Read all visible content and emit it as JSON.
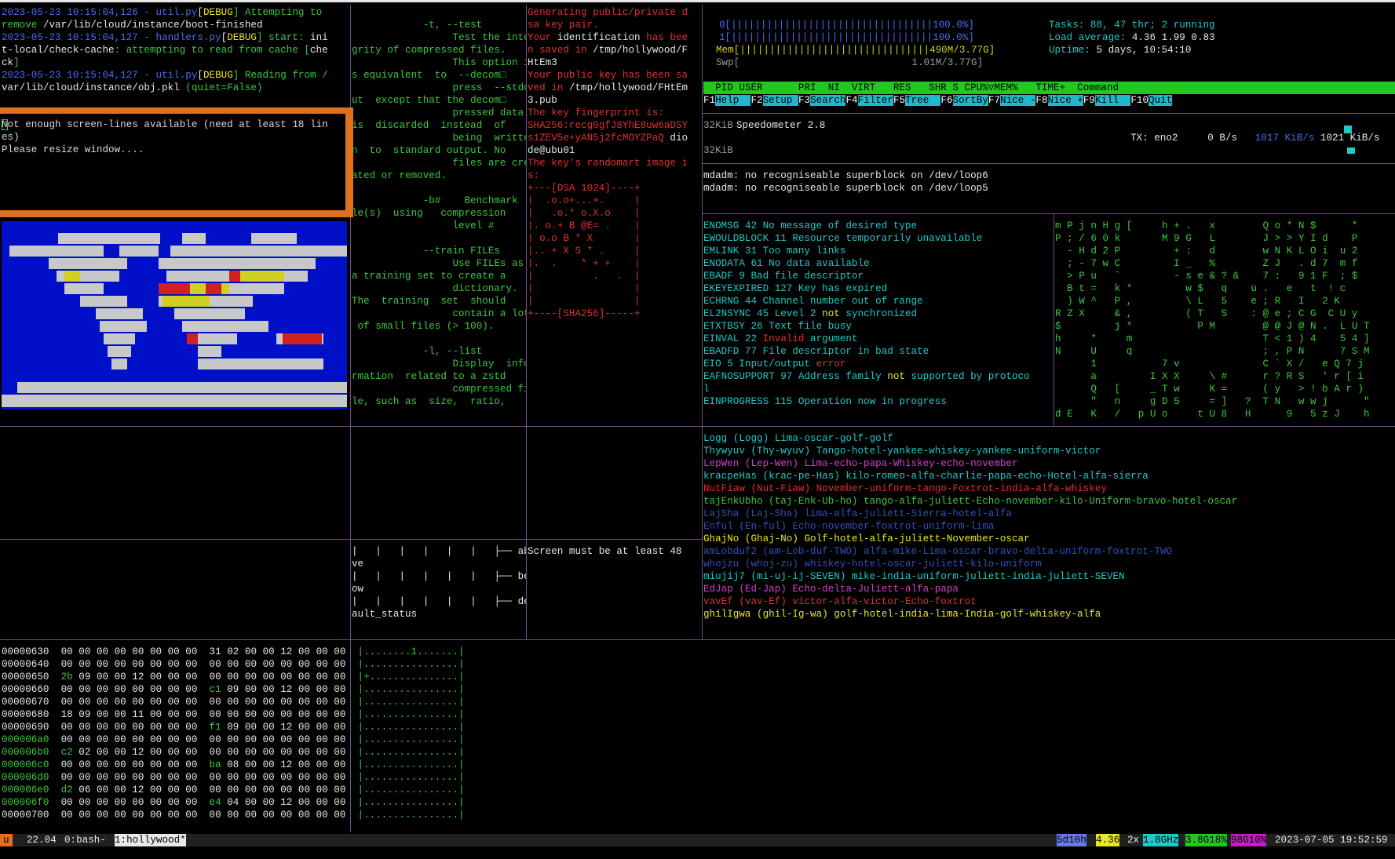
{
  "log_pane": {
    "lines": [
      [
        [
          "2023-05-23 10:15:04,126 - ",
          "c-blue"
        ],
        [
          "util.py",
          "c-blue"
        ],
        [
          "[",
          "c-white"
        ],
        [
          "DEBUG",
          "c-yellow"
        ],
        [
          "] Attempting to",
          "c-green"
        ]
      ],
      [
        [
          "remove ",
          "c-green"
        ],
        [
          "/var/lib/cloud/instance/boot-finished",
          "c-white"
        ]
      ],
      [
        [
          "2023-05-23 10:15:04,127 - ",
          "c-blue"
        ],
        [
          "handlers.py",
          "c-blue"
        ],
        [
          "[",
          "c-white"
        ],
        [
          "DEBUG",
          "c-yellow"
        ],
        [
          "] start: ",
          "c-green"
        ],
        [
          "ini",
          "c-white"
        ]
      ],
      [
        [
          "t-local/check-cache",
          "c-white"
        ],
        [
          ": attempting to read from cache [",
          "c-green"
        ],
        [
          "che",
          "c-white"
        ]
      ],
      [
        [
          "ck",
          "c-white"
        ],
        [
          "]",
          "c-green"
        ]
      ],
      [
        [
          "2023-05-23 10:15:04,127 - ",
          "c-blue"
        ],
        [
          "util.py",
          "c-blue"
        ],
        [
          "[",
          "c-white"
        ],
        [
          "DEBUG",
          "c-yellow"
        ],
        [
          "] Reading from /",
          "c-green"
        ]
      ],
      [
        [
          "var/lib/cloud/instance/obj.pkl",
          "c-white"
        ],
        [
          " (quiet=False)",
          "c-green"
        ]
      ]
    ]
  },
  "warn_pane": {
    "lines": [
      "Not enough screen-lines available (need at least 18 lin",
      "es)",
      "Please resize window...."
    ]
  },
  "zstd_help": {
    "lines": [
      "            -t, --test",
      "                 Test the inte",
      "grity of compressed files.",
      "                 This option i",
      "s equivalent  to  --decom□",
      "                 press  --stdo",
      "ut  except that the decom□",
      "                 pressed data",
      "is  discarded  instead  of",
      "                 being  writte",
      "n  to  standard output. No",
      "                 files are cre",
      "ated or removed.",
      "",
      "            -b#    Benchmark  fi",
      "le(s)  using   compression",
      "                 level #",
      "",
      "            --train FILEs",
      "                 Use FILEs as",
      "a training set to create a",
      "                 dictionary.",
      "The  training  set  should",
      "                 contain a lot",
      " of small files (> 100).",
      "",
      "            -l, --list",
      "                 Display  info",
      "rmation  related to a zstd",
      "                 compressed fi",
      "le, such as  size,  ratio,"
    ]
  },
  "ssh_pane": {
    "lines": [
      [
        [
          "Generating public/private d",
          "c-red"
        ]
      ],
      [
        [
          "sa key pair.",
          "c-red"
        ]
      ],
      [
        [
          "Your ",
          "c-red"
        ],
        [
          "identification",
          "c-white"
        ],
        [
          " has bee",
          "c-red"
        ]
      ],
      [
        [
          "n saved in ",
          "c-red"
        ],
        [
          "/tmp/hollywood/F",
          "c-white"
        ]
      ],
      [
        [
          "HtEm3",
          "c-white"
        ]
      ],
      [
        [
          "Your public key has been sa",
          "c-red"
        ]
      ],
      [
        [
          "ved in ",
          "c-red"
        ],
        [
          "/tmp/hollywood/FHtEm",
          "c-white"
        ]
      ],
      [
        [
          "3.pub",
          "c-white"
        ]
      ],
      [
        [
          "The key fingerprint is:",
          "c-red"
        ]
      ],
      [
        [
          "SHA256:recg0gfJ8YhE8uw6aDSY",
          "c-red"
        ]
      ],
      [
        [
          "s1ZEV5e+yAN5j2fcMOYZPaQ ",
          "c-red"
        ],
        [
          "dio",
          "c-white"
        ]
      ],
      [
        [
          "de@ubu01",
          "c-white"
        ]
      ],
      [
        [
          "The key's randomart image i",
          "c-red"
        ]
      ],
      [
        [
          "s:",
          "c-red"
        ]
      ],
      [
        [
          "+---[DSA 1024]----+",
          "c-red"
        ]
      ],
      [
        [
          "|  .o.o+...+.     |",
          "c-red"
        ]
      ],
      [
        [
          "|   .o.* o.X.o    |",
          "c-red"
        ]
      ],
      [
        [
          "|. o.+ B @E= .    |",
          "c-red"
        ]
      ],
      [
        [
          "| o.o B * X       |",
          "c-red"
        ]
      ],
      [
        [
          "|.. + X S * .     |",
          "c-red"
        ]
      ],
      [
        [
          "|.  .    * + +    |",
          "c-red"
        ]
      ],
      [
        [
          "|          .   .  |",
          "c-red"
        ]
      ],
      [
        [
          "|                 |",
          "c-red"
        ]
      ],
      [
        [
          "|                 |",
          "c-red"
        ]
      ],
      [
        [
          "+----[SHA256]-----+",
          "c-red"
        ]
      ]
    ]
  },
  "htop": {
    "cpu0": "0[||||||||||||||||||||||||||||||||||100.0%]",
    "cpu1": "1[||||||||||||||||||||||||||||||||||100.0%]",
    "mem": "Mem[||||||||||||||||||||||||||||||||490M/3.77G]",
    "swp": "Swp[                             1.01M/3.77G]",
    "tasks_label": "Tasks: ",
    "tasks_value": "88, 47 thr; 2 running",
    "load_label": "Load average: ",
    "load_value": "4.36 1.99 0.83",
    "uptime_label": "Uptime: ",
    "uptime_value": "5 days, 10:54:10",
    "header": "  PID USER      PRI  NI  VIRT   RES   SHR S CPU%▽MEM%   TIME+  Command",
    "fkeys": [
      {
        "key": "F1",
        "label": "Help  "
      },
      {
        "key": "F2",
        "label": "Setup "
      },
      {
        "key": "F3",
        "label": "Search"
      },
      {
        "key": "F4",
        "label": "Filter"
      },
      {
        "key": "F5",
        "label": "Tree  "
      },
      {
        "key": "F6",
        "label": "SortBy"
      },
      {
        "key": "F7",
        "label": "Nice -"
      },
      {
        "key": "F8",
        "label": "Nice +"
      },
      {
        "key": "F9",
        "label": "Kill  "
      },
      {
        "key": "F10",
        "label": "Quit"
      }
    ]
  },
  "speedometer": {
    "top_label": "32KiB",
    "title": "Speedometer 2.8",
    "tx_label": "TX: eno2",
    "rate": "0 B/s",
    "avg": "1017 KiB/s",
    "peak": "1021 KiB/s",
    "bottom_label": "32KiB"
  },
  "mdadm": {
    "lines": [
      "mdadm: no recogniseable superblock on /dev/loop6",
      "mdadm: no recogniseable superblock on /dev/loop5"
    ]
  },
  "errno": {
    "lines": [
      [
        [
          "ENOMSG 42 No message of desired type",
          "c-cyan"
        ]
      ],
      [
        [
          "EWOULDBLOCK 11 Resource temporarily unavailable",
          "c-cyan"
        ]
      ],
      [
        [
          "EMLINK 31 Too many links",
          "c-cyan"
        ]
      ],
      [
        [
          "ENODATA 61 No data available",
          "c-cyan"
        ]
      ],
      [
        [
          "EBADF 9 Bad file descriptor",
          "c-cyan"
        ]
      ],
      [
        [
          "EKEYEXPIRED 127 Key has expired",
          "c-cyan"
        ]
      ],
      [
        [
          "ECHRNG 44 Channel number out of range",
          "c-cyan"
        ]
      ],
      [
        [
          "EL2NSYNC 45 Level 2 ",
          "c-cyan"
        ],
        [
          "not",
          "c-yellow"
        ],
        [
          " synchronized",
          "c-cyan"
        ]
      ],
      [
        [
          "ETXTBSY 26 Text file busy",
          "c-cyan"
        ]
      ],
      [
        [
          "EINVAL 22 ",
          "c-cyan"
        ],
        [
          "Invalid",
          "c-red"
        ],
        [
          " argument",
          "c-cyan"
        ]
      ],
      [
        [
          "EBADFD 77 File descriptor in bad state",
          "c-cyan"
        ]
      ],
      [
        [
          "EIO 5 Input/output ",
          "c-cyan"
        ],
        [
          "error",
          "c-red"
        ]
      ],
      [
        [
          "EAFNOSUPPORT 97 Address family ",
          "c-cyan"
        ],
        [
          "not",
          "c-yellow"
        ],
        [
          " supported by protoco",
          "c-cyan"
        ]
      ],
      [
        [
          "l",
          "c-cyan"
        ]
      ],
      [
        [
          "EINPROGRESS 115 Operation now in progress",
          "c-cyan"
        ]
      ]
    ]
  },
  "matrix": {
    "lines": [
      "m P j n H g [     h + .   x        Q o * N $      *",
      "P ; / 6 0 k       M 9 G   L        J > > Y I d    P",
      "  - H d 2 P         + :   d        w N K L O i  u 2",
      "  ; - 7 w C         I _   %        Z J   . d 7  m f",
      "  > P u   `         - s e & ? &    7 :   9 1 F  ; $",
      "  B t =   k *         w $   q    u .   e   t  ! c",
      "  ) W ^   P ,         \\ L   5    e ; R   I   2 K",
      "R Z X     & ,         ( T   S    : @ e ; C G  C U y",
      "$         j *           P M        @ @ J @ N .  L U T",
      "h     *     m                      T < 1 ) 4    5 4 ]",
      "N     U     q                      ; , P N      7 S M",
      "      1           7 v              C ` X /   e Q 7 j",
      "      a         I X X     \\ #      r ? R S   ' r [ i",
      "      Q   [     _ T w     K =      ( y   > ! b A r )",
      "      \"   n     g D 5     = ]   ?  T N   w w j      \"",
      "d E   K   /   p U o     t U 8   H      9   5 z J    h"
    ]
  },
  "names": {
    "lines": [
      [
        "Logg (Logg) Lima-oscar-golf-golf",
        "c-cyan"
      ],
      [
        "Thywyuv (Thy-wyuv) Tango-hotel-yankee-whiskey-yankee-uniform-victor",
        "c-cyan"
      ],
      [
        "LepWen (Lep-Wen) Lima-echo-papa-Whiskey-echo-november",
        "c-mag"
      ],
      [
        "kracpeHas (krac-pe-Has) kilo-romeo-alfa-charlie-papa-echo-Hotel-alfa-sierra",
        "c-cyan"
      ],
      [
        "NutFiaw (Nut-Fiaw) November-uniform-tango-Foxtrot-india-alfa-whiskey",
        "c-red"
      ],
      [
        "tajEnkUbho (taj-Enk-Ub-ho) tango-alfa-juliett-Echo-november-kilo-Uniform-bravo-hotel-oscar",
        "c-green"
      ],
      [
        "LajSha (Laj-Sha) lima-alfa-juliett-Sierra-hotel-alfa",
        "c-dblue"
      ],
      [
        "Enful (En-ful) Echo-november-foxtrot-uniform-lima",
        "c-dblue"
      ],
      [
        "GhajNo (Ghaj-No) Golf-hotel-alfa-juliett-November-oscar",
        "c-yellow"
      ],
      [
        "amLobduf2 (am-Lob-duf-TWO) alfa-mike-Lima-oscar-bravo-delta-uniform-foxtrot-TWO",
        "c-dblue"
      ],
      [
        "whojzu (whoj-zu) whiskey-hotel-oscar-juliett-kilo-uniform",
        "c-dblue"
      ],
      [
        "miujij7 (mi-uj-ij-SEVEN) mike-india-uniform-juliett-india-juliett-SEVEN",
        "c-cyan"
      ],
      [
        "EdJap (Ed-Jap) Echo-delta-Juliett-alfa-papa",
        "c-mag"
      ],
      [
        "vavEf (vav-Ef) victor-alfa-victor-Echo-foxtrot",
        "c-red"
      ],
      [
        "ghilIgwa (ghil-Ig-wa) golf-hotel-india-lima-India-golf-whiskey-alfa",
        "c-yellow"
      ]
    ]
  },
  "tree_pane": {
    "lines": [
      "|   |   |   |   |   |   ├── abo",
      "ve",
      "|   |   |   |   |   |   ├── bel",
      "ow",
      "|   |   |   |   |   |   ├── def",
      "ault_status"
    ]
  },
  "screen_pane": {
    "text": "Screen must be at least 48"
  },
  "hexdump": {
    "rows": [
      [
        "00000630",
        "00 00 00 00 00 00 00 00",
        "31 02 00 00 12 00 00 00",
        "|........1.......|",
        "",
        ""
      ],
      [
        "00000640",
        "00 00 00 00 00 00 00 00",
        "00 00 00 00 00 00 00 00",
        "|................|",
        "",
        ""
      ],
      [
        "00000650",
        "2b 09 00 00 12 00 00 00",
        "00 00 00 00 00 00 00 00",
        "|+...............|",
        "2b",
        ""
      ],
      [
        "00000660",
        "00 00 00 00 00 00 00 00",
        "c1 09 00 00 12 00 00 00",
        "|................|",
        "",
        "c1"
      ],
      [
        "00000670",
        "00 00 00 00 00 00 00 00",
        "00 00 00 00 00 00 00 00",
        "|................|",
        "",
        ""
      ],
      [
        "00000680",
        "18 09 00 00 11 00 00 00",
        "00 00 00 00 00 00 00 00",
        "|................|",
        "",
        ""
      ],
      [
        "00000690",
        "00 00 00 00 00 00 00 00",
        "f1 09 00 00 12 00 00 00",
        "|................|",
        "",
        "f1"
      ],
      [
        "000006a0",
        "00 00 00 00 00 00 00 00",
        "00 00 00 00 00 00 00 00",
        "|................|",
        "",
        ""
      ],
      [
        "000006b0",
        "c2 02 00 00 12 00 00 00",
        "00 00 00 00 00 00 00 00",
        "|................|",
        "c2",
        ""
      ],
      [
        "000006c0",
        "00 00 00 00 00 00 00 00",
        "ba 08 00 00 12 00 00 00",
        "|................|",
        "",
        "ba"
      ],
      [
        "000006d0",
        "00 00 00 00 00 00 00 00",
        "00 00 00 00 00 00 00 00",
        "|................|",
        "",
        ""
      ],
      [
        "000006e0",
        "d2 06 00 00 12 00 00 00",
        "00 00 00 00 00 00 00 00",
        "|................|",
        "d2",
        ""
      ],
      [
        "000006f0",
        "00 00 00 00 00 00 00 00",
        "e4 04 00 00 12 00 00 00",
        "|................|",
        "",
        "e4"
      ],
      [
        "00000700",
        "00 00 00 00 00 00 00 00",
        "00 00 00 00 00 00 00 00",
        "|................|",
        "",
        ""
      ]
    ]
  },
  "statusbar": {
    "session": "u",
    "load": "22.04",
    "win0": "0:bash-",
    "win1": "1:hollywood*",
    "uptime": "5d10h",
    "loadavg": "4.36",
    "cpu": "2x",
    "freq": "1.8GHz",
    "mem": "3.8G18%",
    "disk": "98G10%",
    "datetime": "2023-07-05 19:52:59"
  },
  "colors": {
    "border": "#7a4a8a",
    "warn_border": "#e07020",
    "map_bg": "#0010c8"
  }
}
